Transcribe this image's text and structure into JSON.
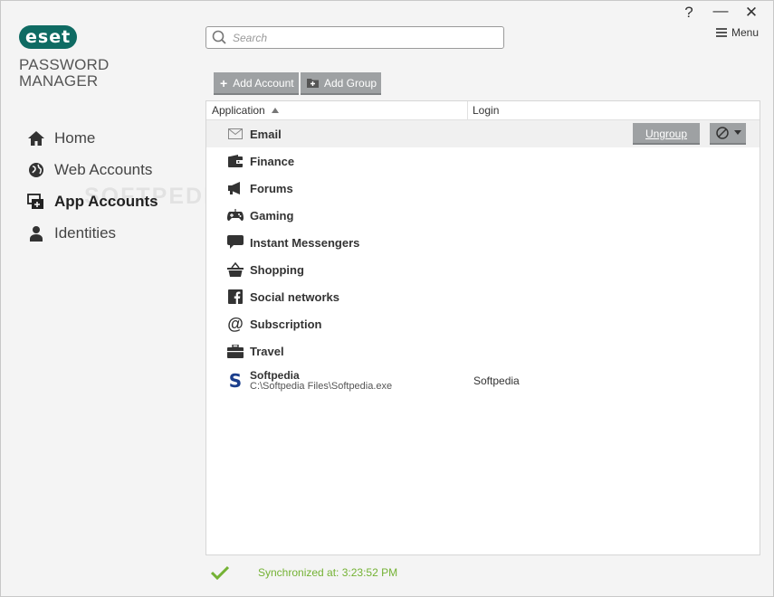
{
  "logo": {
    "badge": "eset",
    "line1": "PASSWORD",
    "line2": "MANAGER"
  },
  "window": {
    "help": "?",
    "minimize": "—",
    "close": "✕",
    "menu_label": "Menu"
  },
  "search": {
    "placeholder": "Search"
  },
  "toolbar": {
    "add_account": "Add Account",
    "add_group": "Add Group"
  },
  "sidebar": {
    "items": [
      {
        "label": "Home",
        "icon": "home-icon"
      },
      {
        "label": "Web Accounts",
        "icon": "globe-icon"
      },
      {
        "label": "App Accounts",
        "icon": "app-windows-icon",
        "active": true
      },
      {
        "label": "Identities",
        "icon": "person-icon"
      }
    ]
  },
  "watermark": "SOFTPEDIA",
  "table": {
    "columns": {
      "application": "Application",
      "login": "Login"
    },
    "groups": [
      {
        "name": "Email",
        "icon": "envelope-icon"
      },
      {
        "name": "Finance",
        "icon": "wallet-icon"
      },
      {
        "name": "Forums",
        "icon": "megaphone-icon"
      },
      {
        "name": "Gaming",
        "icon": "gamepad-icon"
      },
      {
        "name": "Instant Messengers",
        "icon": "chat-bubble-icon"
      },
      {
        "name": "Shopping",
        "icon": "basket-icon"
      },
      {
        "name": "Social networks",
        "icon": "facebook-icon"
      },
      {
        "name": "Subscription",
        "icon": "at-sign-icon"
      },
      {
        "name": "Travel",
        "icon": "suitcase-icon"
      }
    ],
    "ungroup_label": "Ungroup",
    "app": {
      "name": "Softpedia",
      "path": "C:\\Softpedia Files\\Softpedia.exe",
      "login": "Softpedia",
      "icon": "softpedia-s-icon"
    }
  },
  "status": {
    "text": "Synchronized at: 3:23:52 PM"
  },
  "colors": {
    "brand": "#0f6b63",
    "button": "#9ea1a3",
    "sync_green": "#74b234"
  }
}
